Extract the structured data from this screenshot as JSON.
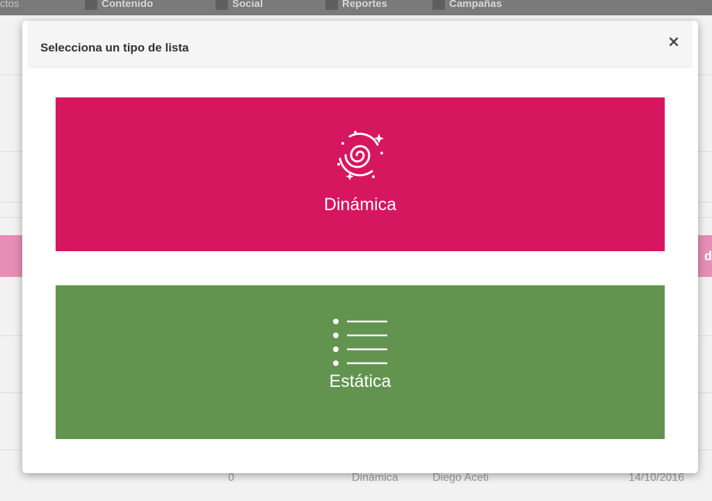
{
  "background": {
    "nav": {
      "fragment": "ctos",
      "items": [
        {
          "label": "Contenido"
        },
        {
          "label": "Social"
        },
        {
          "label": "Reportes"
        },
        {
          "label": "Campañas"
        }
      ]
    },
    "pink_band_fragment": "d",
    "bottom_row": {
      "count": "0",
      "type": "Dinámica",
      "owner": "Diego Aceti",
      "date": "14/10/2016"
    }
  },
  "modal": {
    "title": "Selecciona un tipo de lista",
    "close_label": "×",
    "options": [
      {
        "label": "Dinámica",
        "icon": "spiral-galaxy-icon",
        "color": "#d71660"
      },
      {
        "label": "Estática",
        "icon": "bullet-list-icon",
        "color": "#629450"
      }
    ]
  }
}
